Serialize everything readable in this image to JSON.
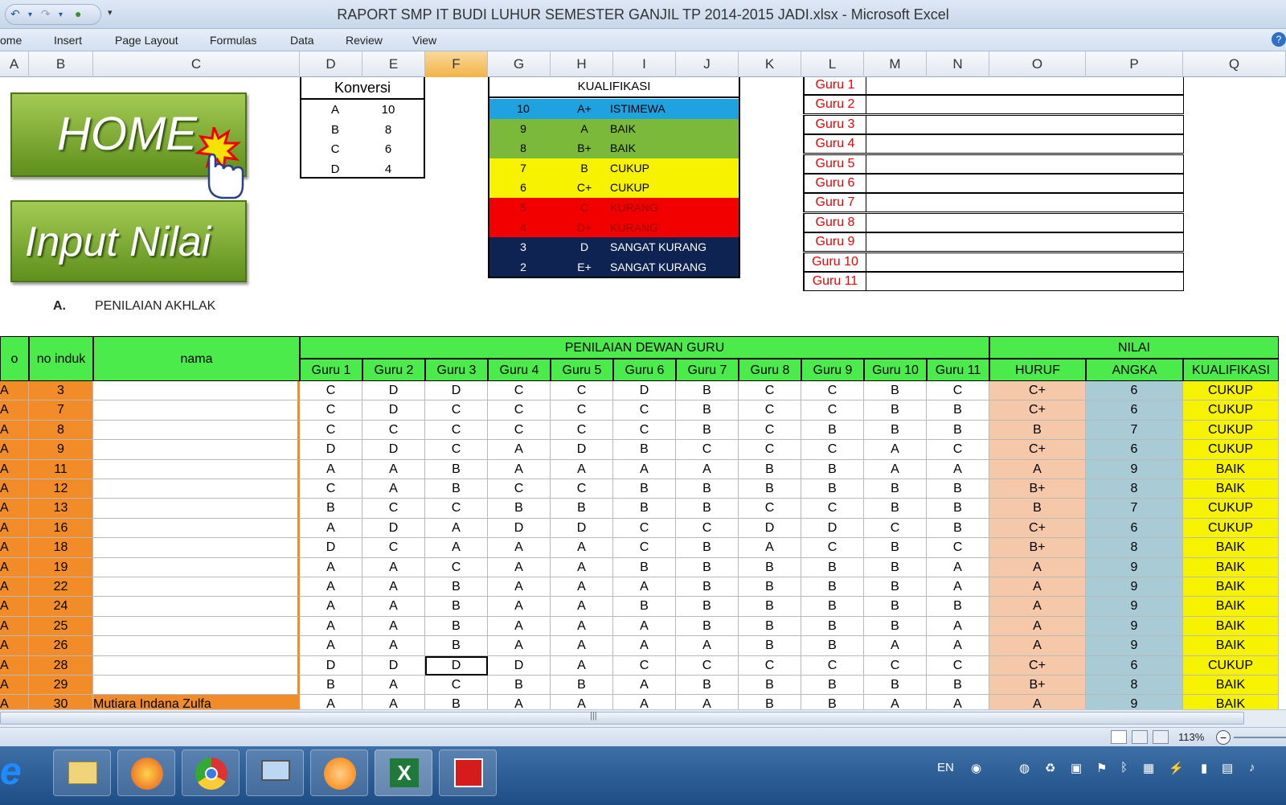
{
  "window": {
    "title": "RAPORT SMP IT BUDI LUHUR SEMESTER GANJIL TP 2014-2015 JADI.xlsx - Microsoft Excel"
  },
  "ribbon": {
    "tabs": [
      "ome",
      "Insert",
      "Page Layout",
      "Formulas",
      "Data",
      "Review",
      "View"
    ]
  },
  "columns": [
    "A",
    "B",
    "C",
    "D",
    "E",
    "F",
    "G",
    "H",
    "I",
    "J",
    "K",
    "L",
    "M",
    "N",
    "O",
    "P",
    "Q"
  ],
  "buttons": {
    "home": "HOME",
    "input": "Input Nilai"
  },
  "section": {
    "letter": "A.",
    "title": "PENILAIAN AKHLAK"
  },
  "konversi": {
    "title": "Konversi",
    "rows": [
      [
        "A",
        "10"
      ],
      [
        "B",
        "8"
      ],
      [
        "C",
        "6"
      ],
      [
        "D",
        "4"
      ]
    ]
  },
  "kualifikasi": {
    "title": "KUALIFIKASI",
    "rows": [
      {
        "angka": "10",
        "huruf": "A+",
        "ket": "ISTIMEWA",
        "bg": "#1fa2e0",
        "fg": "#000"
      },
      {
        "angka": "9",
        "huruf": "A",
        "ket": "BAIK",
        "bg": "#7ab93a",
        "fg": "#000"
      },
      {
        "angka": "8",
        "huruf": "B+",
        "ket": "BAIK",
        "bg": "#7ab93a",
        "fg": "#000"
      },
      {
        "angka": "7",
        "huruf": "B",
        "ket": "CUKUP",
        "bg": "#f7f200",
        "fg": "#000"
      },
      {
        "angka": "6",
        "huruf": "C+",
        "ket": "CUKUP",
        "bg": "#f7f200",
        "fg": "#000"
      },
      {
        "angka": "5",
        "huruf": "C",
        "ket": "KURANG",
        "bg": "#f20000",
        "fg": "#9b0000"
      },
      {
        "angka": "4",
        "huruf": "D+",
        "ket": "KURANG",
        "bg": "#f20000",
        "fg": "#9b0000"
      },
      {
        "angka": "3",
        "huruf": "D",
        "ket": "SANGAT KURANG",
        "bg": "#0e2351",
        "fg": "#fff"
      },
      {
        "angka": "2",
        "huruf": "E+",
        "ket": "SANGAT KURANG",
        "bg": "#0e2351",
        "fg": "#fff"
      }
    ]
  },
  "guru_list": [
    "Guru 1",
    "Guru 2",
    "Guru 3",
    "Guru 4",
    "Guru 5",
    "Guru 6",
    "Guru 7",
    "Guru 8",
    "Guru 9",
    "Guru 10",
    "Guru 11"
  ],
  "table": {
    "h_a": "o",
    "h_noinduk": "no induk",
    "h_nama": "nama",
    "h_dewan": "PENILAIAN DEWAN GURU",
    "h_nilai": "NILAI",
    "gurus": [
      "Guru 1",
      "Guru 2",
      "Guru 3",
      "Guru 4",
      "Guru 5",
      "Guru 6",
      "Guru 7",
      "Guru 8",
      "Guru 9",
      "Guru 10",
      "Guru 11"
    ],
    "h_huruf": "HURUF",
    "h_angka": "ANGKA",
    "h_kual": "KUALIFIKASI",
    "rows": [
      {
        "a": "A",
        "no": "3",
        "nama": "",
        "g": [
          "C",
          "D",
          "D",
          "C",
          "C",
          "D",
          "B",
          "C",
          "C",
          "B",
          "C"
        ],
        "huruf": "C+",
        "angka": "6",
        "kual": "CUKUP"
      },
      {
        "a": "A",
        "no": "7",
        "nama": "",
        "g": [
          "C",
          "D",
          "C",
          "C",
          "C",
          "C",
          "B",
          "C",
          "C",
          "B",
          "B"
        ],
        "huruf": "C+",
        "angka": "6",
        "kual": "CUKUP"
      },
      {
        "a": "A",
        "no": "8",
        "nama": "",
        "g": [
          "C",
          "C",
          "C",
          "C",
          "C",
          "C",
          "B",
          "C",
          "B",
          "B",
          "B"
        ],
        "huruf": "B",
        "angka": "7",
        "kual": "CUKUP"
      },
      {
        "a": "A",
        "no": "9",
        "nama": "",
        "g": [
          "D",
          "D",
          "C",
          "A",
          "D",
          "B",
          "C",
          "C",
          "C",
          "A",
          "C"
        ],
        "huruf": "C+",
        "angka": "6",
        "kual": "CUKUP"
      },
      {
        "a": "A",
        "no": "11",
        "nama": "",
        "g": [
          "A",
          "A",
          "B",
          "A",
          "A",
          "A",
          "A",
          "B",
          "B",
          "A",
          "A"
        ],
        "huruf": "A",
        "angka": "9",
        "kual": "BAIK"
      },
      {
        "a": "A",
        "no": "12",
        "nama": "",
        "g": [
          "C",
          "A",
          "B",
          "C",
          "C",
          "B",
          "B",
          "B",
          "B",
          "B",
          "B"
        ],
        "huruf": "B+",
        "angka": "8",
        "kual": "BAIK"
      },
      {
        "a": "A",
        "no": "13",
        "nama": "",
        "g": [
          "B",
          "C",
          "C",
          "B",
          "B",
          "B",
          "B",
          "C",
          "C",
          "B",
          "B"
        ],
        "huruf": "B",
        "angka": "7",
        "kual": "CUKUP"
      },
      {
        "a": "A",
        "no": "16",
        "nama": "",
        "g": [
          "A",
          "D",
          "A",
          "D",
          "D",
          "C",
          "C",
          "D",
          "D",
          "C",
          "B"
        ],
        "huruf": "C+",
        "angka": "6",
        "kual": "CUKUP"
      },
      {
        "a": "A",
        "no": "18",
        "nama": "",
        "g": [
          "D",
          "C",
          "A",
          "A",
          "A",
          "C",
          "B",
          "A",
          "C",
          "B",
          "C"
        ],
        "huruf": "B+",
        "angka": "8",
        "kual": "BAIK"
      },
      {
        "a": "A",
        "no": "19",
        "nama": "",
        "g": [
          "A",
          "A",
          "C",
          "A",
          "A",
          "B",
          "B",
          "B",
          "B",
          "B",
          "A"
        ],
        "huruf": "A",
        "angka": "9",
        "kual": "BAIK"
      },
      {
        "a": "A",
        "no": "22",
        "nama": "",
        "g": [
          "A",
          "A",
          "B",
          "A",
          "A",
          "A",
          "B",
          "B",
          "B",
          "B",
          "A"
        ],
        "huruf": "A",
        "angka": "9",
        "kual": "BAIK"
      },
      {
        "a": "A",
        "no": "24",
        "nama": "",
        "g": [
          "A",
          "A",
          "B",
          "A",
          "A",
          "B",
          "B",
          "B",
          "B",
          "B",
          "B"
        ],
        "huruf": "A",
        "angka": "9",
        "kual": "BAIK"
      },
      {
        "a": "A",
        "no": "25",
        "nama": "",
        "g": [
          "A",
          "A",
          "B",
          "A",
          "A",
          "A",
          "B",
          "B",
          "B",
          "B",
          "A"
        ],
        "huruf": "A",
        "angka": "9",
        "kual": "BAIK"
      },
      {
        "a": "A",
        "no": "26",
        "nama": "",
        "g": [
          "A",
          "A",
          "B",
          "A",
          "A",
          "A",
          "A",
          "B",
          "B",
          "A",
          "A"
        ],
        "huruf": "A",
        "angka": "9",
        "kual": "BAIK"
      },
      {
        "a": "A",
        "no": "28",
        "nama": "",
        "g": [
          "D",
          "D",
          "D",
          "D",
          "A",
          "C",
          "C",
          "C",
          "C",
          "C",
          "C"
        ],
        "huruf": "C+",
        "angka": "6",
        "kual": "CUKUP"
      },
      {
        "a": "A",
        "no": "29",
        "nama": "",
        "g": [
          "B",
          "A",
          "C",
          "B",
          "B",
          "A",
          "B",
          "B",
          "B",
          "B",
          "B"
        ],
        "huruf": "B+",
        "angka": "8",
        "kual": "BAIK"
      },
      {
        "a": "A",
        "no": "30",
        "nama": "Mutiara Indana Zulfa",
        "g": [
          "A",
          "A",
          "B",
          "A",
          "A",
          "A",
          "A",
          "B",
          "B",
          "A",
          "A"
        ],
        "huruf": "A",
        "angka": "9",
        "kual": "BAIK"
      }
    ]
  },
  "status": {
    "zoom": "113%"
  },
  "taskbar": {
    "lang": "EN",
    "icons": [
      "ie-icon",
      "explorer-icon",
      "firefox-icon",
      "chrome-icon",
      "computer-icon",
      "media-icon",
      "excel-icon",
      "acrobat-icon"
    ]
  },
  "colors": {
    "header_green": "#4ceb4c",
    "orange": "#f28c28",
    "salmon": "#f4c8a8",
    "blue": "#a9cbd6",
    "yellow": "#f7f200"
  }
}
